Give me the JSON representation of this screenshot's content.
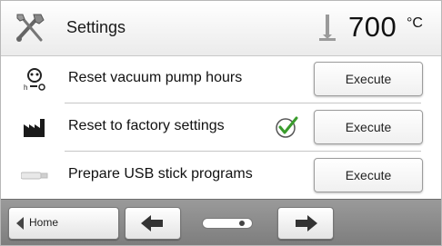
{
  "header": {
    "title": "Settings",
    "temperature": "700",
    "unit": "°C",
    "icon": "tools-icon",
    "thermo_icon": "thermometer-icon"
  },
  "rows": [
    {
      "label": "Reset vacuum pump hours",
      "button": "Execute",
      "icon": "vacuum-pump-icon",
      "checked": false
    },
    {
      "label": "Reset to factory settings",
      "button": "Execute",
      "icon": "factory-icon",
      "checked": true
    },
    {
      "label": "Prepare USB stick programs",
      "button": "Execute",
      "icon": "usb-stick-icon",
      "checked": false
    }
  ],
  "footer": {
    "home_label": "Home",
    "back_icon": "arrow-left-icon",
    "forward_icon": "arrow-right-icon",
    "indicator_icon": "usb-indicator-icon"
  },
  "colors": {
    "header_bg": "#ebebeb",
    "footer_bg": "#8a8a8a",
    "check": "#3a9c2c",
    "button_border": "#9c9c9c"
  }
}
